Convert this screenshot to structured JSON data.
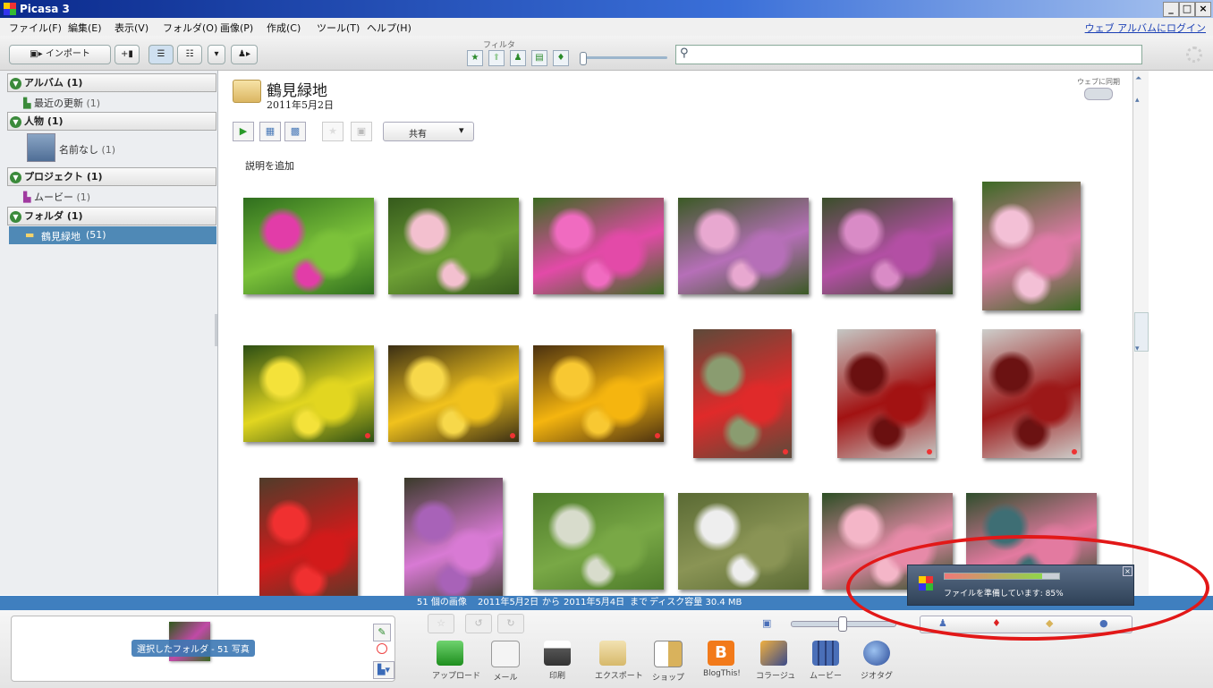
{
  "window": {
    "title": "Picasa 3",
    "min": "_",
    "max": "□",
    "close": "×"
  },
  "menu": [
    "ファイル(F)",
    "編集(E)",
    "表示(V)",
    "フォルダ(O)",
    "画像(P)",
    "作成(C)",
    "ツール(T)",
    "ヘルプ(H)"
  ],
  "web_login": "ウェブ アルバムにログイン",
  "toolbar": {
    "import": "インポート",
    "filter_label": "フィルタ"
  },
  "sidebar": {
    "groups": [
      {
        "label": "アルバム (1)",
        "items": [
          {
            "label": "最近の更新",
            "count": "(1)"
          }
        ]
      },
      {
        "label": "人物 (1)",
        "items": [
          {
            "label": "名前なし",
            "count": "(1)"
          }
        ]
      },
      {
        "label": "プロジェクト (1)",
        "items": [
          {
            "label": "ムービー",
            "count": "(1)"
          }
        ]
      },
      {
        "label": "フォルダ (1)",
        "items": [
          {
            "label": "鶴見緑地",
            "count": "(51)"
          }
        ]
      }
    ]
  },
  "folder": {
    "title": "鶴見緑地",
    "date": "2011年5月2日",
    "sync_label": "ウェブに同期",
    "share": "共有",
    "add_caption": "説明を追加"
  },
  "photos": [
    {
      "colors": [
        "#2f6e1e",
        "#7cc23a",
        "#e23ca8"
      ]
    },
    {
      "colors": [
        "#355a1c",
        "#6ea035",
        "#f3c0cf"
      ]
    },
    {
      "colors": [
        "#3b6b20",
        "#e34aa8",
        "#f06bc0"
      ]
    },
    {
      "colors": [
        "#3a5a24",
        "#b66fb8",
        "#e8a8d0"
      ]
    },
    {
      "colors": [
        "#3a4f2a",
        "#b34fa4",
        "#d98bc6"
      ]
    },
    {
      "colors": [
        "#3c6a24",
        "#e07aa8",
        "#f3c0d6"
      ]
    },
    {
      "colors": [
        "#2c4e14",
        "#e2d620",
        "#f4e23a"
      ]
    },
    {
      "colors": [
        "#3a2e14",
        "#f1c21d",
        "#f7d84a"
      ]
    },
    {
      "colors": [
        "#4a3010",
        "#f5b50f",
        "#f8c832"
      ]
    },
    {
      "colors": [
        "#5d4a3a",
        "#e02a2a",
        "#8a9c70"
      ]
    },
    {
      "colors": [
        "#c5c7c4",
        "#a21212",
        "#6a1010"
      ]
    },
    {
      "colors": [
        "#cdcecb",
        "#9c1818",
        "#6b1212"
      ]
    },
    {
      "colors": [
        "#4f3c2a",
        "#d21a1a",
        "#f03030"
      ]
    },
    {
      "colors": [
        "#3a3a2a",
        "#d87ad4",
        "#a862b8"
      ]
    },
    {
      "colors": [
        "#4d7a2a",
        "#79a846",
        "#d8dccc"
      ]
    },
    {
      "colors": [
        "#5a6a34",
        "#8a9455",
        "#eeeeee"
      ]
    },
    {
      "colors": [
        "#2c4e24",
        "#e68aa8",
        "#f4b6c8"
      ]
    },
    {
      "colors": [
        "#2f4e2c",
        "#e37aa0",
        "#3e6e74"
      ]
    }
  ],
  "status": {
    "count": "51 個の画像",
    "date1": "2011年5月2日",
    "from": "から",
    "date2": "2011年5月4日",
    "until": "まで",
    "disk": "ディスク容量 30.4 MB"
  },
  "tray": {
    "selection": "選択したフォルダ - 51 写真"
  },
  "bottom_actions": [
    "アップロード",
    "メール",
    "印刷",
    "エクスポート",
    "ショップ",
    "BlogThis!",
    "コラージュ",
    "ムービー",
    "ジオタグ"
  ],
  "popup": {
    "text": "ファイルを準備しています: 85%",
    "progress": 0.85
  }
}
